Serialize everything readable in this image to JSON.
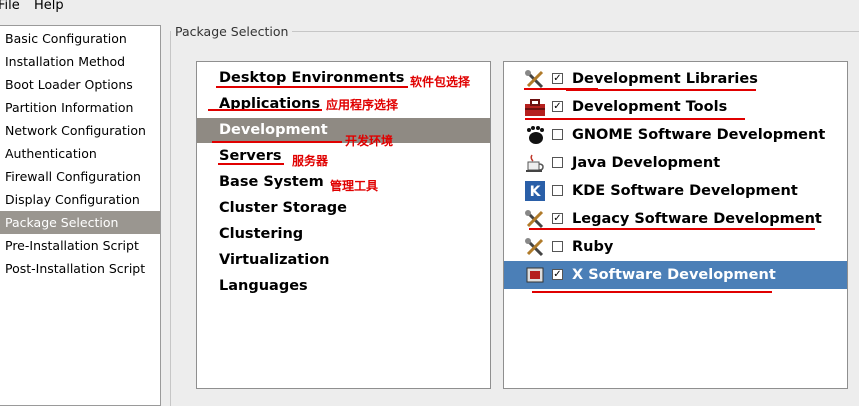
{
  "menu": {
    "file": "File",
    "help": "Help"
  },
  "sidebar": {
    "items": [
      {
        "label": "Basic Configuration"
      },
      {
        "label": "Installation Method"
      },
      {
        "label": "Boot Loader Options"
      },
      {
        "label": "Partition Information"
      },
      {
        "label": "Network Configuration"
      },
      {
        "label": "Authentication"
      },
      {
        "label": "Firewall Configuration"
      },
      {
        "label": "Display Configuration"
      },
      {
        "label": "Package Selection"
      },
      {
        "label": "Pre-Installation Script"
      },
      {
        "label": "Post-Installation Script"
      }
    ],
    "selected": "Package Selection"
  },
  "frame": {
    "title": "Package Selection"
  },
  "groups": {
    "items": [
      {
        "label": "Desktop Environments"
      },
      {
        "label": "Applications"
      },
      {
        "label": "Development"
      },
      {
        "label": "Servers"
      },
      {
        "label": "Base System"
      },
      {
        "label": "Cluster Storage"
      },
      {
        "label": "Clustering"
      },
      {
        "label": "Virtualization"
      },
      {
        "label": "Languages"
      }
    ],
    "selected": "Development"
  },
  "packages": {
    "items": [
      {
        "label": "Development Libraries",
        "checked": true,
        "icon": "tools-icon"
      },
      {
        "label": "Development Tools",
        "checked": true,
        "icon": "toolbox-icon"
      },
      {
        "label": "GNOME Software Development",
        "checked": false,
        "icon": "gnome-foot-icon"
      },
      {
        "label": "Java Development",
        "checked": false,
        "icon": "java-cup-icon"
      },
      {
        "label": "KDE Software Development",
        "checked": false,
        "icon": "kde-icon"
      },
      {
        "label": "Legacy Software Development",
        "checked": true,
        "icon": "tools-icon"
      },
      {
        "label": "Ruby",
        "checked": false,
        "icon": "tools-icon"
      },
      {
        "label": "X Software Development",
        "checked": true,
        "icon": "x-window-icon"
      }
    ],
    "selected": "X Software Development"
  },
  "annotations": {
    "desktop": "软件包选择",
    "applications": "应用程序选择",
    "development": "开发环境",
    "servers": "服务器",
    "base_system": "管理工具"
  },
  "colors": {
    "selection_blue": "#4b7fb7",
    "selection_gray": "#8f8a83",
    "annotation_red": "#e00000"
  }
}
